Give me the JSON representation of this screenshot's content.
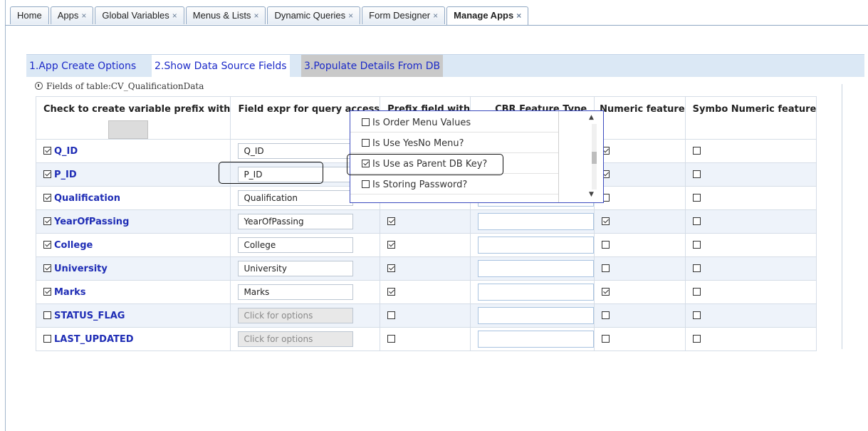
{
  "tabs": [
    {
      "label": "Home",
      "closable": false,
      "active": false
    },
    {
      "label": "Apps",
      "closable": true,
      "active": false
    },
    {
      "label": "Global Variables",
      "closable": true,
      "active": false
    },
    {
      "label": "Menus & Lists",
      "closable": true,
      "active": false
    },
    {
      "label": "Dynamic Queries",
      "closable": true,
      "active": false
    },
    {
      "label": "Form Designer",
      "closable": true,
      "active": false
    },
    {
      "label": "Manage Apps",
      "closable": true,
      "active": true
    }
  ],
  "close_glyph": "×",
  "wizard": {
    "step1": "1.App Create Options",
    "step2": "2.Show Data Source Fields",
    "step3": "3.Populate Details From DB",
    "active_step": 2
  },
  "table_caption": "Fields of table:CV_QualificationData",
  "columns": {
    "c1": "Check to create variable prefix with",
    "c2": "Field expr for query access",
    "c3": "Prefix  field  with",
    "c4": "CBR Feature Type",
    "c5": "Numeric feature",
    "c6": "Symbo Numeric feature"
  },
  "rows": [
    {
      "name": "Q_ID",
      "checked": true,
      "expr": "Q_ID",
      "disabled": false,
      "prefix": true,
      "numeric": true,
      "symbo": false
    },
    {
      "name": "P_ID",
      "checked": true,
      "expr": "P_ID",
      "disabled": false,
      "prefix": true,
      "numeric": true,
      "symbo": false
    },
    {
      "name": "Qualification",
      "checked": true,
      "expr": "Qualification",
      "disabled": false,
      "prefix": true,
      "numeric": false,
      "symbo": false
    },
    {
      "name": "YearOfPassing",
      "checked": true,
      "expr": "YearOfPassing",
      "disabled": false,
      "prefix": true,
      "numeric": true,
      "symbo": false
    },
    {
      "name": "College",
      "checked": true,
      "expr": "College",
      "disabled": false,
      "prefix": true,
      "numeric": false,
      "symbo": false
    },
    {
      "name": "University",
      "checked": true,
      "expr": "University",
      "disabled": false,
      "prefix": true,
      "numeric": false,
      "symbo": false
    },
    {
      "name": "Marks",
      "checked": true,
      "expr": "Marks",
      "disabled": false,
      "prefix": true,
      "numeric": true,
      "symbo": false
    },
    {
      "name": "STATUS_FLAG",
      "checked": false,
      "expr": "Click for options",
      "disabled": true,
      "prefix": false,
      "numeric": false,
      "symbo": false
    },
    {
      "name": "LAST_UPDATED",
      "checked": false,
      "expr": "Click for options",
      "disabled": true,
      "prefix": false,
      "numeric": false,
      "symbo": false
    }
  ],
  "popup": {
    "items": [
      {
        "label": "Is Order Menu Values",
        "checked": false
      },
      {
        "label": "Is Use YesNo Menu?",
        "checked": false
      },
      {
        "label": "Is Use as Parent DB Key?",
        "checked": true
      },
      {
        "label": "Is Storing Password?",
        "checked": false
      }
    ],
    "scroll_up": "▲",
    "scroll_down": "▼"
  },
  "colors": {
    "accent_text": "#1f2db5",
    "wizard_bg": "#dbe8f5",
    "popup_border": "#3b4bbf"
  }
}
